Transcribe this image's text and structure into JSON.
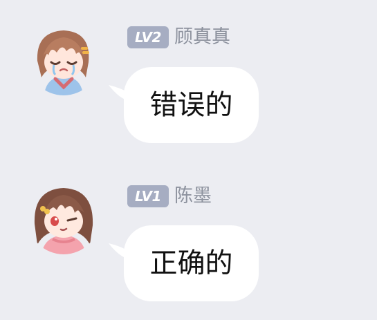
{
  "messages": [
    {
      "level_badge": "LV2",
      "username": "顾真真",
      "text": "错误的",
      "avatar": "anime-girl-crying-avatar"
    },
    {
      "level_badge": "LV1",
      "username": "陈墨",
      "text": "正确的",
      "avatar": "anime-girl-winking-avatar"
    }
  ],
  "colors": {
    "background": "#ecedf2",
    "bubble": "#ffffff",
    "badge": "#a6adc2",
    "username": "#8d929e",
    "text": "#111111"
  }
}
